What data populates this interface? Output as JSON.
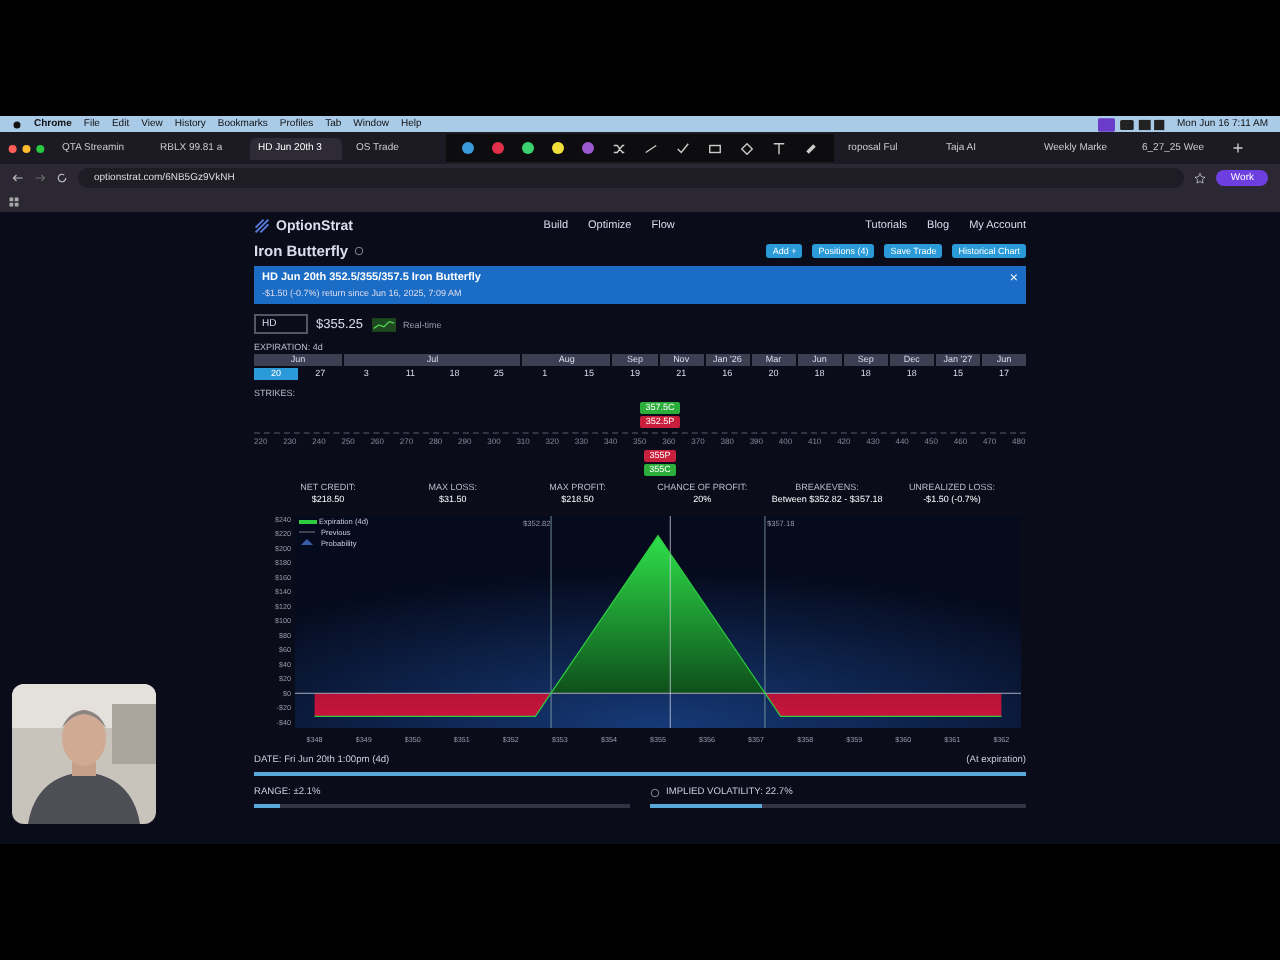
{
  "menubar": {
    "items": [
      "Chrome",
      "File",
      "Edit",
      "View",
      "History",
      "Bookmarks",
      "Profiles",
      "Tab",
      "Window",
      "Help"
    ],
    "clock": "Mon Jun 16  7:11 AM"
  },
  "browser_tabs": [
    {
      "label": "QTA Streamin",
      "selected": false
    },
    {
      "label": "RBLX 99.81 a",
      "selected": false
    },
    {
      "label": "HD Jun 20th 3",
      "selected": true
    },
    {
      "label": "OS Trade",
      "selected": false
    }
  ],
  "annotation_toolbar": {
    "colors": [
      {
        "color": "#3a9ad9"
      },
      {
        "color": "#e0304a"
      },
      {
        "color": "#3bd16f"
      },
      {
        "color": "#f2e03a"
      },
      {
        "color": "#9b59d0"
      }
    ]
  },
  "browser_tabs_right": [
    {
      "label": "roposal Ful",
      "selected": false
    },
    {
      "label": "Taja AI",
      "selected": false
    },
    {
      "label": "Weekly Marke",
      "selected": false
    },
    {
      "label": "6_27_25 Wee",
      "selected": false
    }
  ],
  "address_bar": {
    "url": "optionstrat.com/6NB5Gz9VkNH",
    "profile": "Work"
  },
  "app_nav": {
    "logo": "OptionStrat",
    "items": [
      "Build",
      "Optimize",
      "Flow"
    ],
    "right_items": [
      "Tutorials",
      "Blog",
      "My Account"
    ]
  },
  "strategy": {
    "title": "Iron Butterfly",
    "buttons": [
      "Add +",
      "Positions (4)",
      "Save Trade",
      "Historical Chart"
    ]
  },
  "banner": {
    "title": "HD Jun 20th 352.5/355/357.5 Iron Butterfly",
    "subtitle": "-$1.50 (-0.7%) return since Jun 16, 2025, 7:09 AM",
    "close": "×"
  },
  "quote": {
    "symbol": "HD",
    "price": "$355.25",
    "realtime": "Real-time"
  },
  "expiration": {
    "label": "EXPIRATION: 4d",
    "months": [
      {
        "label": "Jun",
        "dates": [
          {
            "day": "20",
            "selected": true
          },
          {
            "day": "27",
            "selected": false
          }
        ]
      },
      {
        "label": "Jul",
        "dates": [
          {
            "day": "3",
            "selected": false
          },
          {
            "day": "11",
            "selected": false
          },
          {
            "day": "18",
            "selected": false
          },
          {
            "day": "25",
            "selected": false
          }
        ]
      },
      {
        "label": "Aug",
        "dates": [
          {
            "day": "1",
            "selected": false
          },
          {
            "day": "15",
            "selected": false
          }
        ]
      },
      {
        "label": "Sep",
        "dates": [
          {
            "day": "19",
            "selected": false
          }
        ]
      },
      {
        "label": "Nov",
        "dates": [
          {
            "day": "21",
            "selected": false
          }
        ]
      },
      {
        "label": "Jan '26",
        "dates": [
          {
            "day": "16",
            "selected": false
          }
        ]
      },
      {
        "label": "Mar",
        "dates": [
          {
            "day": "20",
            "selected": false
          }
        ]
      },
      {
        "label": "Jun",
        "dates": [
          {
            "day": "18",
            "selected": false
          }
        ]
      },
      {
        "label": "Sep",
        "dates": [
          {
            "day": "18",
            "selected": false
          }
        ]
      },
      {
        "label": "Dec",
        "dates": [
          {
            "day": "18",
            "selected": false
          }
        ]
      },
      {
        "label": "Jan '27",
        "dates": [
          {
            "day": "15",
            "selected": false
          }
        ]
      },
      {
        "label": "Jun",
        "dates": [
          {
            "day": "17",
            "selected": false
          }
        ]
      }
    ]
  },
  "strikes": {
    "label": "STRIKES:",
    "above": [
      {
        "label": "357.5C",
        "kind": "call"
      },
      {
        "label": "352.5P",
        "kind": "put"
      }
    ],
    "ticks": [
      "220",
      "230",
      "240",
      "250",
      "260",
      "270",
      "280",
      "290",
      "300",
      "310",
      "320",
      "330",
      "340",
      "350",
      "360",
      "370",
      "380",
      "390",
      "400",
      "410",
      "420",
      "430",
      "440",
      "450",
      "460",
      "470",
      "480"
    ],
    "below": [
      {
        "label": "355P",
        "kind": "put"
      },
      {
        "label": "355C",
        "kind": "call"
      }
    ]
  },
  "stats": [
    {
      "label": "NET CREDIT:",
      "value": "$218.50"
    },
    {
      "label": "MAX LOSS:",
      "value": "$31.50"
    },
    {
      "label": "MAX PROFIT:",
      "value": "$218.50"
    },
    {
      "label": "CHANCE OF PROFIT:",
      "value": "20%"
    },
    {
      "label": "BREAKEVENS:",
      "value": "Between $352.82 - $357.18"
    },
    {
      "label": "UNREALIZED LOSS:",
      "value": "-$1.50 (-0.7%)"
    }
  ],
  "chart": {
    "legend": [
      "Previous",
      "Probability"
    ],
    "chart_data": {
      "type": "line",
      "x": [
        348,
        352.5,
        352.82,
        355,
        357.18,
        357.5,
        362
      ],
      "series": [
        {
          "name": "Expiration (4d)",
          "color": "#2ecc40",
          "values": [
            -32,
            -32,
            0,
            218,
            0,
            -32,
            -32
          ]
        }
      ],
      "ref_lines": [
        {
          "axis": "x",
          "value": 352.82,
          "label": "$352.82"
        },
        {
          "axis": "x",
          "value": 357.18,
          "label": "$357.18"
        },
        {
          "axis": "x",
          "value": 355.25
        }
      ],
      "xlim": [
        347.6,
        362.4
      ],
      "ylim": [
        -48,
        245
      ],
      "xticks": [
        {
          "value": 348,
          "label": "$348"
        },
        {
          "value": 349,
          "label": "$349"
        },
        {
          "value": 350,
          "label": "$350"
        },
        {
          "value": 351,
          "label": "$351"
        },
        {
          "value": 352,
          "label": "$352"
        },
        {
          "value": 353,
          "label": "$353"
        },
        {
          "value": 354,
          "label": "$354"
        },
        {
          "value": 355,
          "label": "$355"
        },
        {
          "value": 356,
          "label": "$356"
        },
        {
          "value": 357,
          "label": "$357"
        },
        {
          "value": 358,
          "label": "$358"
        },
        {
          "value": 359,
          "label": "$359"
        },
        {
          "value": 360,
          "label": "$360"
        },
        {
          "value": 361,
          "label": "$361"
        },
        {
          "value": 362,
          "label": "$362"
        }
      ],
      "yticks": [
        {
          "value": 240,
          "label": "$240"
        },
        {
          "value": 220,
          "label": "$220"
        },
        {
          "value": 200,
          "label": "$200"
        },
        {
          "value": 180,
          "label": "$180"
        },
        {
          "value": 160,
          "label": "$160"
        },
        {
          "value": 140,
          "label": "$140"
        },
        {
          "value": 120,
          "label": "$120"
        },
        {
          "value": 100,
          "label": "$100"
        },
        {
          "value": 80,
          "label": "$80"
        },
        {
          "value": 60,
          "label": "$60"
        },
        {
          "value": 40,
          "label": "$40"
        },
        {
          "value": 20,
          "label": "$20"
        },
        {
          "value": 0,
          "label": "$0"
        },
        {
          "value": -20,
          "label": "-$20"
        },
        {
          "value": -40,
          "label": "-$40"
        }
      ]
    }
  },
  "date": {
    "label": "DATE: Fri Jun 20th 1:00pm (4d)",
    "note": "(At expiration)",
    "level": 1
  },
  "range": {
    "label": "RANGE: ±2.1%",
    "level": 0.07
  },
  "implied_volatility": {
    "label": "IMPLIED VOLATILITY: 22.7%",
    "level": 0.3
  }
}
